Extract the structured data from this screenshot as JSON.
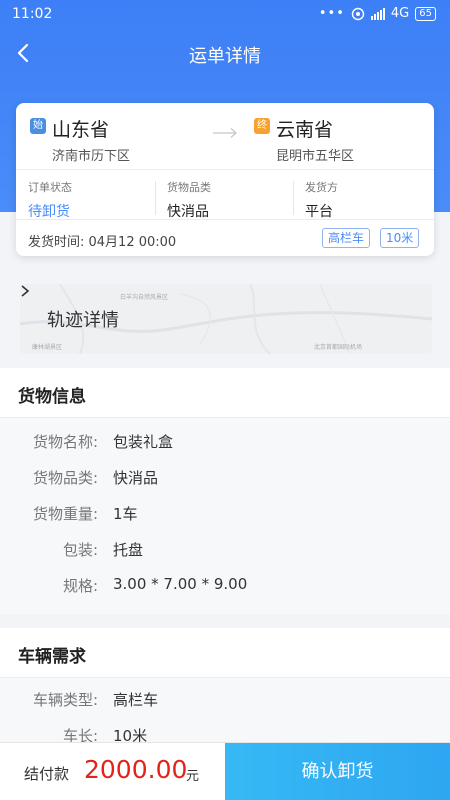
{
  "status_bar": {
    "time": "11:02",
    "dots": "•••",
    "network": "4G",
    "battery": "65"
  },
  "nav": {
    "title": "运单详情"
  },
  "route": {
    "from": {
      "badge": "始",
      "province": "山东省",
      "district": "济南市历下区"
    },
    "to": {
      "badge": "终",
      "province": "云南省",
      "district": "昆明市五华区"
    },
    "info": [
      {
        "label": "订单状态",
        "value": "待卸货"
      },
      {
        "label": "货物品类",
        "value": "快消品"
      },
      {
        "label": "发货方",
        "value": "平台"
      }
    ],
    "ship_time": "发货时间: 04月12 00:00",
    "tags": [
      "高栏车",
      "10米"
    ]
  },
  "map": {
    "label": "轨迹详情",
    "tiny_labels": [
      "白羊沟自然风景区",
      "康林湖景区",
      "北京首都国际机场"
    ]
  },
  "goods": {
    "title": "货物信息",
    "rows": [
      {
        "key": "货物名称:",
        "value": "包装礼盒"
      },
      {
        "key": "货物品类:",
        "value": "快消品"
      },
      {
        "key": "货物重量:",
        "value": "1车"
      },
      {
        "key": "包装:",
        "value": "托盘"
      },
      {
        "key": "规格:",
        "value": "3.00 * 7.00 * 9.00"
      }
    ]
  },
  "vehicle": {
    "title": "车辆需求",
    "rows": [
      {
        "key": "车辆类型:",
        "value": "高栏车"
      },
      {
        "key": "车长:",
        "value": "10米"
      }
    ]
  },
  "bottom": {
    "pay_label": "结付款",
    "amount": "2000.00",
    "unit": "元",
    "confirm": "确认卸货"
  },
  "colors": {
    "primary": "#4a8cf8",
    "from_badge": "#4a90e2",
    "to_badge": "#f5a230",
    "amount": "#e2231a",
    "confirm": "#2ea6f2"
  }
}
